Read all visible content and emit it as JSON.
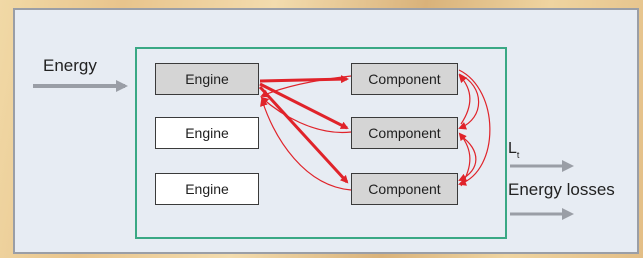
{
  "input": {
    "label": "Energy"
  },
  "engines": [
    {
      "label": "Engine"
    },
    {
      "label": "Engine"
    },
    {
      "label": "Engine"
    }
  ],
  "components": [
    {
      "label": "Component"
    },
    {
      "label": "Component"
    },
    {
      "label": "Component"
    }
  ],
  "outputs": {
    "lt_main": "L",
    "lt_sub": "t",
    "losses": "Energy losses"
  },
  "colors": {
    "frame": "#3aa884",
    "arrow_flow": "#e0232a",
    "arrow_io": "#9a9ea6",
    "panel": "#e7ecf3"
  }
}
